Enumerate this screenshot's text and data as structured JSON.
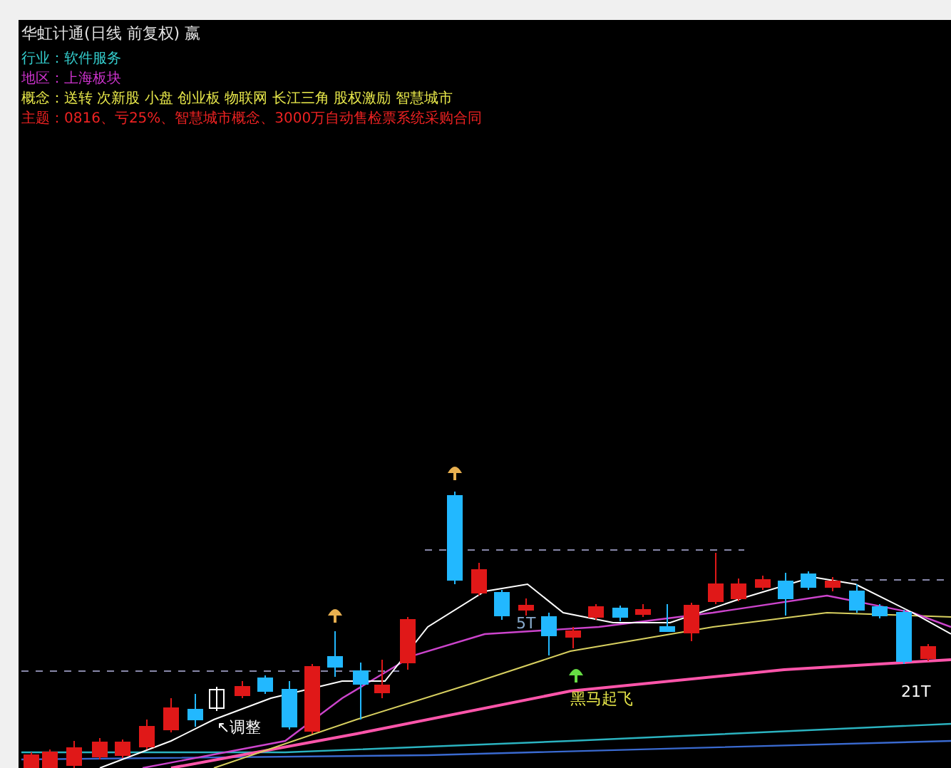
{
  "title": "华虹计通(日线 前复权) 嬴",
  "info_rows": [
    {
      "label": "行业：",
      "value": "软件服务",
      "color": "#33cccc"
    },
    {
      "label": "地区：",
      "value": "上海板块",
      "color": "#cc33cc"
    },
    {
      "label": "概念：",
      "value": "送转 次新股 小盘 创业板 物联网 长江三角 股权激励 智慧城市",
      "color": "#e8e84a"
    },
    {
      "label": "主题：",
      "value": "0816、亏25%、智慧城市概念、3000万自动售检票系统采购合同",
      "color": "#ee2222"
    }
  ],
  "chart_labels": [
    {
      "text": "↖调整",
      "kind": "note"
    },
    {
      "text": "5T",
      "kind": "count"
    },
    {
      "text": "黑马起飞",
      "kind": "signal"
    },
    {
      "text": "21T",
      "kind": "count"
    }
  ]
}
